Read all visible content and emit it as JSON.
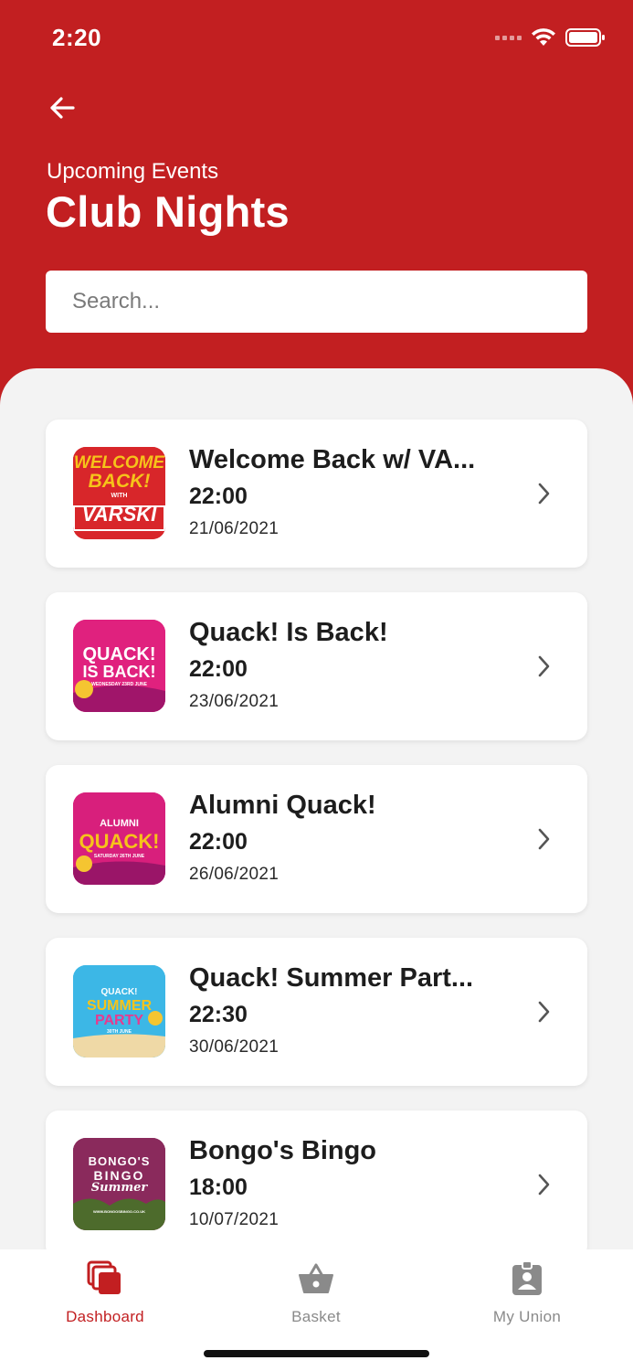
{
  "status": {
    "time": "2:20"
  },
  "header": {
    "subtitle": "Upcoming Events",
    "title": "Club Nights"
  },
  "search": {
    "placeholder": "Search..."
  },
  "events": [
    {
      "title": "Welcome Back w/ VA...",
      "time": "22:00",
      "date": "21/06/2021",
      "thumb_lines": [
        "WELCOME",
        "BACK!",
        "WITH",
        "VARSKI"
      ]
    },
    {
      "title": "Quack! Is Back!",
      "time": "22:00",
      "date": "23/06/2021",
      "thumb_lines": [
        "QUACK!",
        "IS BACK!",
        "WEDNESDAY 23RD JUNE"
      ]
    },
    {
      "title": "Alumni Quack!",
      "time": "22:00",
      "date": "26/06/2021",
      "thumb_lines": [
        "ALUMNI",
        "QUACK!",
        "SATURDAY 26TH JUNE"
      ]
    },
    {
      "title": "Quack! Summer Part...",
      "time": "22:30",
      "date": "30/06/2021",
      "thumb_lines": [
        "QUACK!",
        "SUMMER",
        "PARTY",
        "30TH JUNE"
      ]
    },
    {
      "title": "Bongo's Bingo",
      "time": "18:00",
      "date": "10/07/2021",
      "thumb_lines": [
        "BONGO'S",
        "BINGO",
        "Summer",
        "WWW.BONGOSBINGO.CO.UK"
      ]
    }
  ],
  "tabs": [
    {
      "label": "Dashboard",
      "icon": "dashboard-icon",
      "active": true
    },
    {
      "label": "Basket",
      "icon": "basket-icon",
      "active": false
    },
    {
      "label": "My Union",
      "icon": "id-badge-icon",
      "active": false
    }
  ],
  "colors": {
    "brand_red": "#c21f21",
    "background": "#f3f3f3",
    "tab_inactive": "#8a8a8a"
  }
}
